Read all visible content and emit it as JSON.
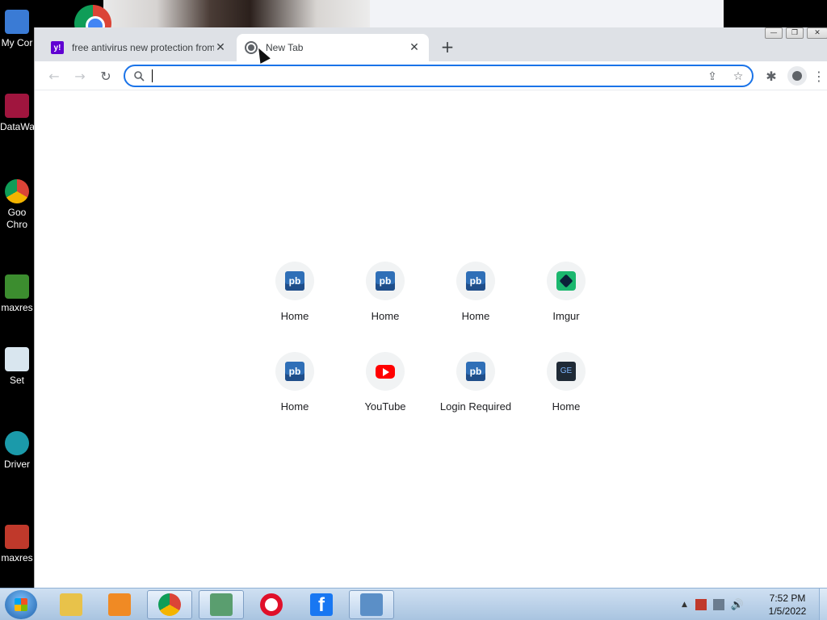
{
  "desktop": {
    "icons": [
      {
        "label": "My Cor",
        "color": "#3a7bd5"
      },
      {
        "label": "DataWa",
        "color": "#a0153e"
      },
      {
        "label": "Goo Chro",
        "color": "#34a853"
      },
      {
        "label": "maxres",
        "color": "#3c8d2f"
      },
      {
        "label": "Set",
        "color": "#d9e6ef"
      },
      {
        "label": "Driver",
        "color": "#1b9aaa"
      },
      {
        "label": "maxres",
        "color": "#c0392b"
      }
    ]
  },
  "browser": {
    "tabs": [
      {
        "title": "free antivirus new protection from",
        "favicon": "yahoo-icon",
        "favicon_text": "y!",
        "close": "✕"
      },
      {
        "title": "New Tab",
        "favicon": "globe-icon",
        "close": "✕"
      }
    ],
    "new_tab": "+",
    "toolbar": {
      "back": "←",
      "forward": "→",
      "reload": "↻",
      "omnibox_value": "",
      "share_icon": "⇪",
      "star_icon": "☆",
      "extensions_icon": "✱",
      "menu_icon": "⋮"
    },
    "window_controls": {
      "minimize": "—",
      "restore": "❐",
      "close": "✕"
    },
    "shortcuts": [
      {
        "label": "Home",
        "icon": "pb-icon",
        "icon_text": "pb"
      },
      {
        "label": "Home",
        "icon": "pb-icon",
        "icon_text": "pb"
      },
      {
        "label": "Home",
        "icon": "pb-icon",
        "icon_text": "pb"
      },
      {
        "label": "Imgur",
        "icon": "imgur-icon"
      },
      {
        "label": "Home",
        "icon": "pb-icon",
        "icon_text": "pb"
      },
      {
        "label": "YouTube",
        "icon": "youtube-icon"
      },
      {
        "label": "Login Required",
        "icon": "pb-icon",
        "icon_text": "pb"
      },
      {
        "label": "Home",
        "icon": "ge-icon",
        "icon_text": "GE"
      }
    ]
  },
  "taskbar": {
    "apps": [
      {
        "name": "file-explorer-icon",
        "color": "#e8c24a"
      },
      {
        "name": "media-player-icon",
        "color": "#f08a24"
      },
      {
        "name": "chrome-icon",
        "color": "#4285f4"
      },
      {
        "name": "notepad-icon",
        "color": "#5a9e6f"
      },
      {
        "name": "opera-icon",
        "color": "#e0102a"
      },
      {
        "name": "facebook-icon",
        "color": "#1877f2",
        "text": "f"
      },
      {
        "name": "photo-viewer-icon",
        "color": "#5b8fc7"
      }
    ],
    "clock_time": "7:52 PM",
    "clock_date": "1/5/2022",
    "tray_arrow": "▲",
    "volume_icon": "🔊"
  }
}
